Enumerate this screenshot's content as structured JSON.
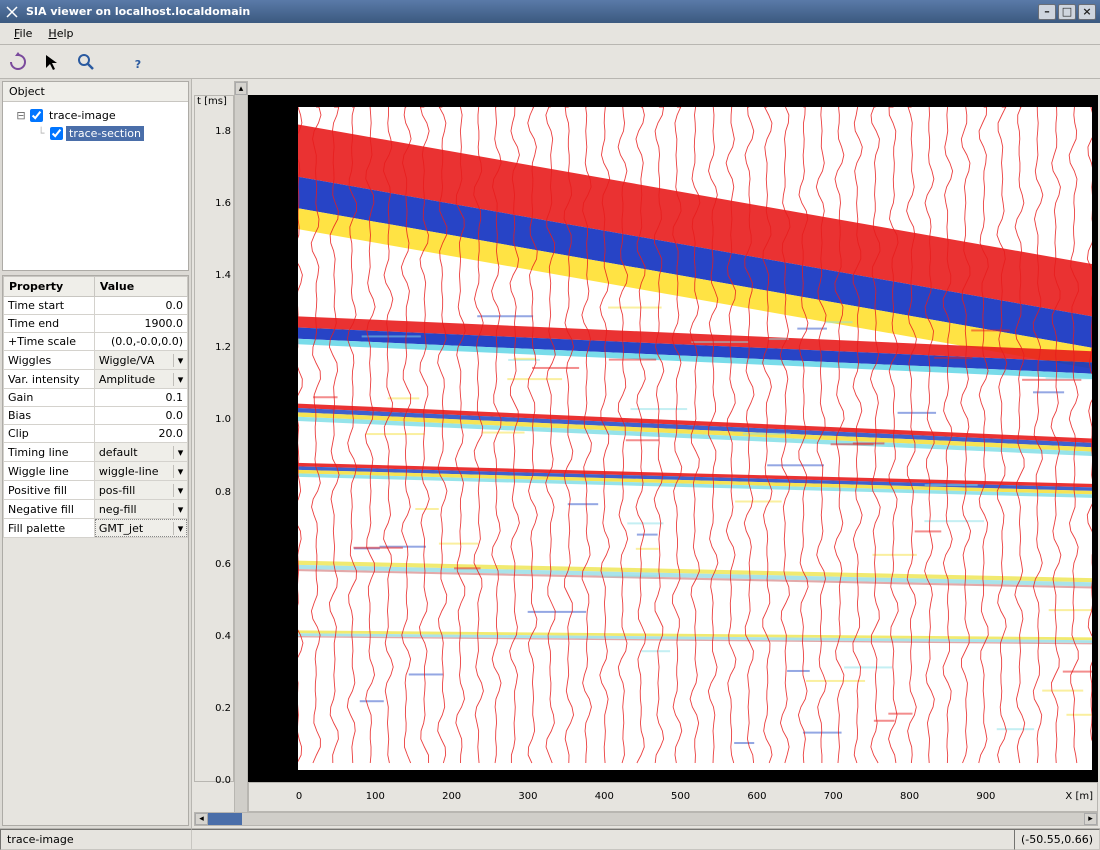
{
  "window": {
    "title": "SIA viewer on localhost.localdomain"
  },
  "menu": {
    "file": "File",
    "help": "Help"
  },
  "toolbar": {
    "rotate": "rotate-icon",
    "pointer": "pointer-icon",
    "zoom": "zoom-icon",
    "about": "help-icon"
  },
  "tree": {
    "header": "Object",
    "items": [
      {
        "label": "trace-image",
        "checked": true,
        "expanded": true,
        "selected": false
      },
      {
        "label": "trace-section",
        "checked": true,
        "expanded": false,
        "selected": true
      }
    ]
  },
  "props": {
    "headers": {
      "property": "Property",
      "value": "Value"
    },
    "rows": [
      {
        "name": "Time start",
        "value": "0.0",
        "type": "text"
      },
      {
        "name": "Time end",
        "value": "1900.0",
        "type": "text"
      },
      {
        "name": "+Time scale",
        "value": "(0.0,-0.0,0.0)",
        "type": "text"
      },
      {
        "name": "Wiggles",
        "value": "Wiggle/VA",
        "type": "dropdown"
      },
      {
        "name": "Var. intensity",
        "value": "Amplitude",
        "type": "dropdown"
      },
      {
        "name": "Gain",
        "value": "0.1",
        "type": "text"
      },
      {
        "name": "Bias",
        "value": "0.0",
        "type": "text"
      },
      {
        "name": "Clip",
        "value": "20.0",
        "type": "text"
      },
      {
        "name": "Timing line",
        "value": "default",
        "type": "dropdown"
      },
      {
        "name": "Wiggle line",
        "value": "wiggle-line",
        "type": "dropdown"
      },
      {
        "name": "Positive fill",
        "value": "pos-fill",
        "type": "dropdown"
      },
      {
        "name": "Negative fill",
        "value": "neg-fill",
        "type": "dropdown"
      },
      {
        "name": "Fill palette",
        "value": "GMT_jet",
        "type": "dropdown",
        "boxed": true
      }
    ]
  },
  "plot": {
    "ylabel": "t [ms]",
    "xlabel": "X [m]",
    "yticks": [
      "1.8",
      "1.6",
      "1.4",
      "1.2",
      "1.0",
      "0.8",
      "0.6",
      "0.4",
      "0.2",
      "0.0"
    ],
    "xticks": [
      "0",
      "100",
      "200",
      "300",
      "400",
      "500",
      "600",
      "700",
      "800",
      "900"
    ]
  },
  "status": {
    "left": "trace-image",
    "right": "(-50.55,0.66)"
  },
  "chart_data": {
    "type": "heatmap",
    "title": "",
    "xlabel": "X [m]",
    "ylabel": "t [ms]",
    "x_range": [
      0,
      1000
    ],
    "y_range": [
      0.0,
      1.9
    ],
    "y_direction": "up",
    "palette": "GMT_jet",
    "note": "Seismic trace section with wiggle/variable-area overlay; high-amplitude reflectors appear as red/blue bands. Vertical wiggle traces drawn in red at roughly 20 X-unit spacing.",
    "reflector_bands_t": [
      {
        "t_left": 1.85,
        "t_right": 1.45,
        "thickness": 0.3,
        "color": "red-blue-strong"
      },
      {
        "t_left": 1.3,
        "t_right": 1.2,
        "thickness": 0.08,
        "color": "red-blue"
      },
      {
        "t_left": 1.05,
        "t_right": 0.95,
        "thickness": 0.05,
        "color": "mixed"
      },
      {
        "t_left": 0.88,
        "t_right": 0.82,
        "thickness": 0.04,
        "color": "mixed"
      },
      {
        "t_left": 0.6,
        "t_right": 0.55,
        "thickness": 0.03,
        "color": "light"
      },
      {
        "t_left": 0.4,
        "t_right": 0.38,
        "thickness": 0.02,
        "color": "light"
      }
    ]
  }
}
